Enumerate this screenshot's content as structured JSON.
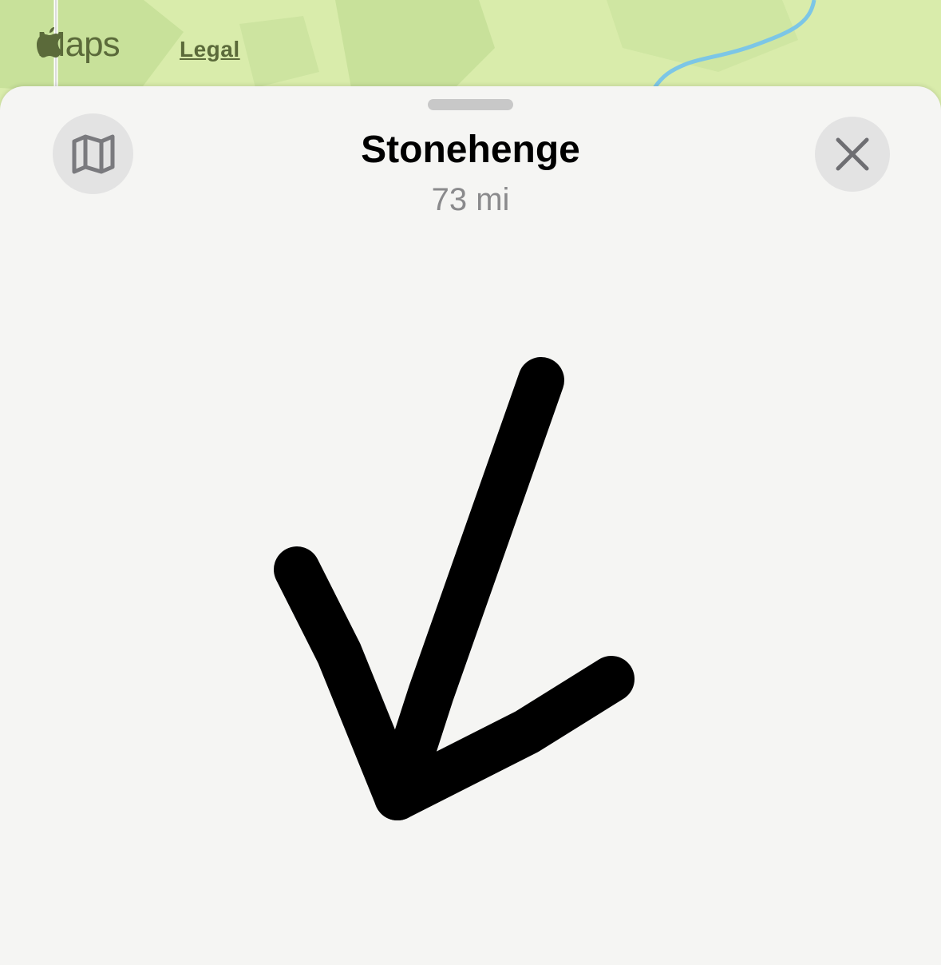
{
  "map": {
    "brand_label": "Maps",
    "legal_label": "Legal",
    "colors": {
      "land": "#d6e9a8",
      "land_dark": "#c5df95",
      "water": "#7cc6e6",
      "road": "#ffffff"
    }
  },
  "sheet": {
    "title": "Stonehenge",
    "distance": "73 mi",
    "map_button_icon": "map-icon",
    "close_button_icon": "close-icon",
    "direction_icon": "arrow-down-left-icon"
  }
}
